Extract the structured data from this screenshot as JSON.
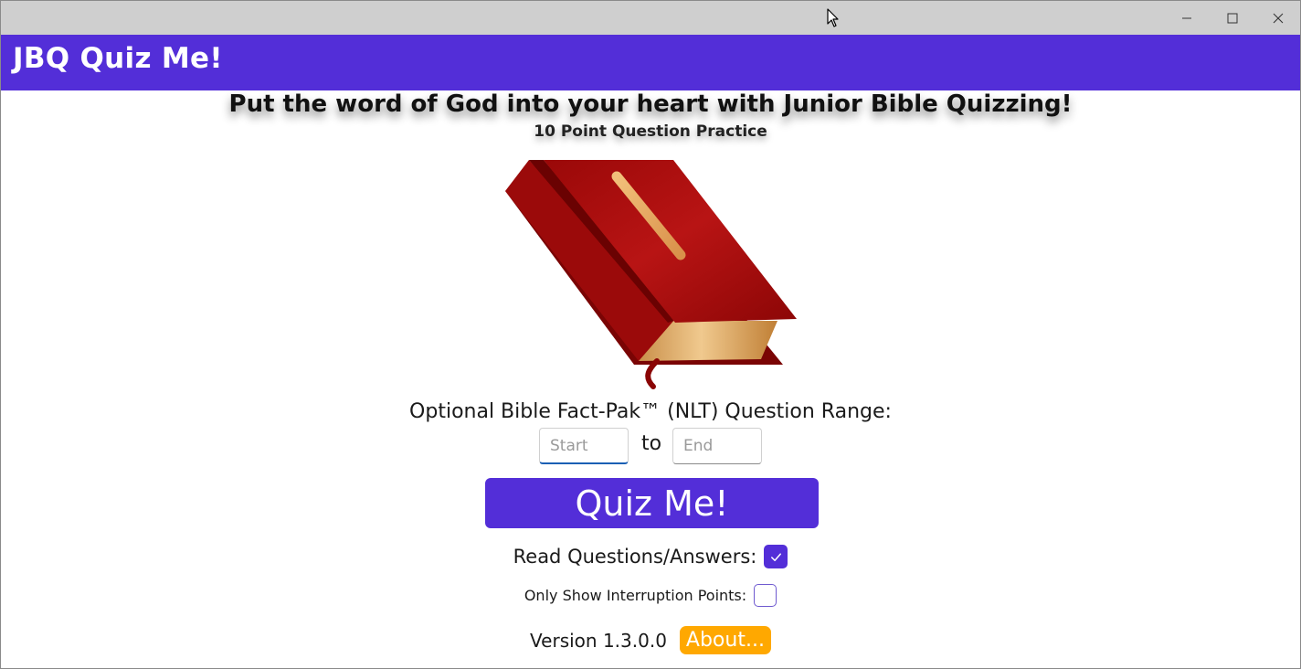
{
  "window": {
    "minimize_icon": "minimize-icon",
    "maximize_icon": "maximize-icon",
    "close_icon": "close-icon"
  },
  "app": {
    "title": "JBQ Quiz Me!",
    "accent_color": "#532ed8"
  },
  "main": {
    "headline": "Put the word of God into your heart with Junior Bible Quizzing!",
    "subhead": "10 Point Question Practice",
    "image_icon": "bible-icon",
    "range_label": "Optional Bible Fact-Pak™ (NLT) Question Range:",
    "range_start_placeholder": "Start",
    "range_to": "to",
    "range_end_placeholder": "End",
    "quiz_button": "Quiz Me!",
    "read_label": "Read Questions/Answers:",
    "read_checked": true,
    "interrupt_label": "Only Show Interruption Points:",
    "interrupt_checked": false,
    "version": "Version 1.3.0.0",
    "about_button": "About...",
    "about_color": "#ffa800"
  }
}
